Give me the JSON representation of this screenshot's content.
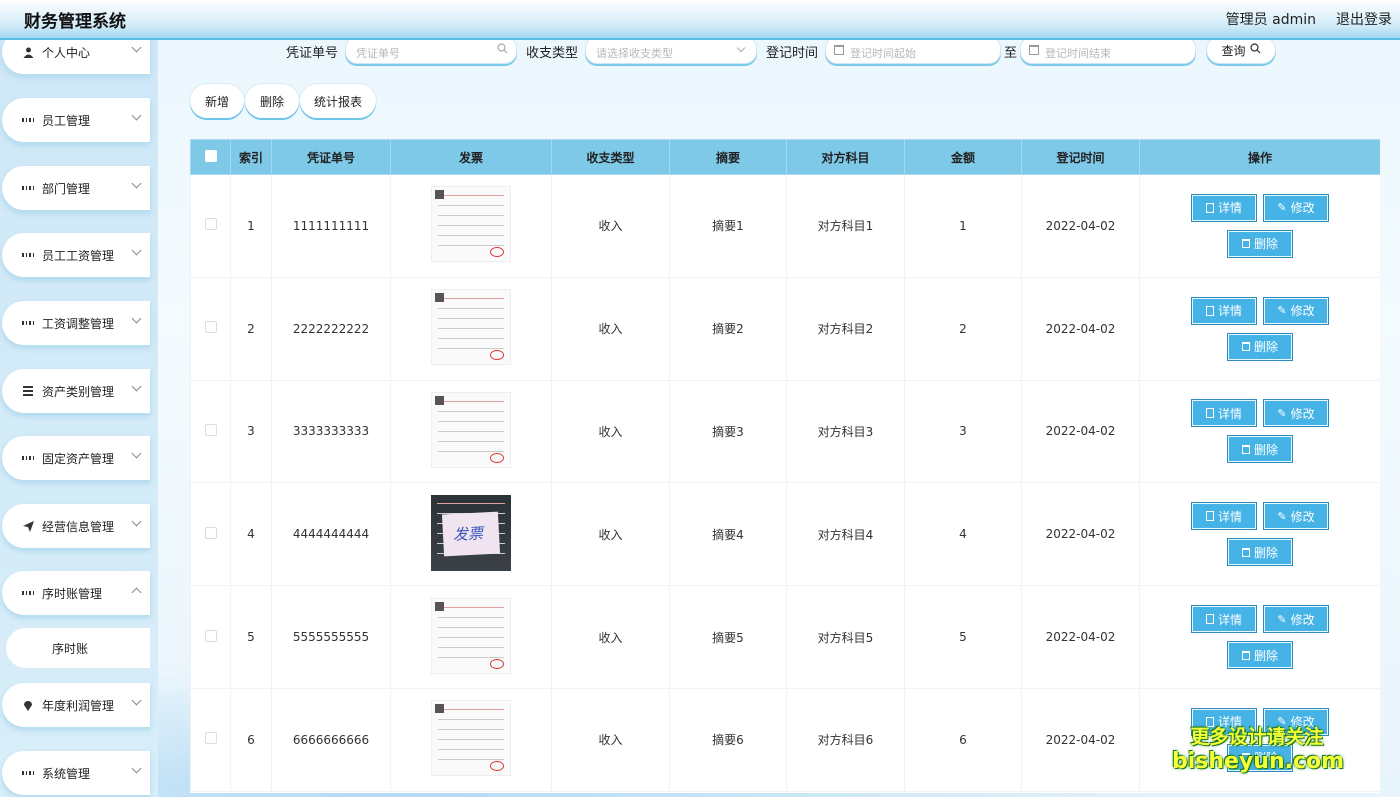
{
  "header": {
    "title": "财务管理系统",
    "user": "管理员 admin",
    "logout": "退出登录"
  },
  "sidebar": {
    "items": [
      {
        "label": "个人中心",
        "icon": "user-icon"
      },
      {
        "label": "员工管理",
        "icon": "grid-icon"
      },
      {
        "label": "部门管理",
        "icon": "grid-icon"
      },
      {
        "label": "员工工资管理",
        "icon": "grid-icon"
      },
      {
        "label": "工资调整管理",
        "icon": "grid-icon"
      },
      {
        "label": "资产类别管理",
        "icon": "list-icon"
      },
      {
        "label": "固定资产管理",
        "icon": "grid-icon"
      },
      {
        "label": "经营信息管理",
        "icon": "send-icon"
      },
      {
        "label": "序时账管理",
        "icon": "grid-icon"
      },
      {
        "label": "年度利润管理",
        "icon": "pin-icon"
      },
      {
        "label": "系统管理",
        "icon": "grid-icon"
      }
    ],
    "sub_item": "序时账"
  },
  "search": {
    "voucher_label": "凭证单号",
    "voucher_placeholder": "凭证单号",
    "type_label": "收支类型",
    "type_placeholder": "请选择收支类型",
    "time_label": "登记时间",
    "time_start_placeholder": "登记时间起始",
    "to_label": "至",
    "time_end_placeholder": "登记时间结束",
    "query_button": "查询"
  },
  "actions": {
    "add": "新增",
    "delete": "删除",
    "report": "统计报表"
  },
  "table": {
    "headers": [
      "索引",
      "凭证单号",
      "发票",
      "收支类型",
      "摘要",
      "对方科目",
      "金额",
      "登记时间",
      "操作"
    ],
    "rows": [
      {
        "index": "1",
        "voucher": "1111111111",
        "type": "收入",
        "summary": "摘要1",
        "account": "对方科目1",
        "amount": "1",
        "date": "2022-04-02"
      },
      {
        "index": "2",
        "voucher": "2222222222",
        "type": "收入",
        "summary": "摘要2",
        "account": "对方科目2",
        "amount": "2",
        "date": "2022-04-02"
      },
      {
        "index": "3",
        "voucher": "3333333333",
        "type": "收入",
        "summary": "摘要3",
        "account": "对方科目3",
        "amount": "3",
        "date": "2022-04-02"
      },
      {
        "index": "4",
        "voucher": "4444444444",
        "type": "收入",
        "summary": "摘要4",
        "account": "对方科目4",
        "amount": "4",
        "date": "2022-04-02"
      },
      {
        "index": "5",
        "voucher": "5555555555",
        "type": "收入",
        "summary": "摘要5",
        "account": "对方科目5",
        "amount": "5",
        "date": "2022-04-02"
      },
      {
        "index": "6",
        "voucher": "6666666666",
        "type": "收入",
        "summary": "摘要6",
        "account": "对方科目6",
        "amount": "6",
        "date": "2022-04-02"
      }
    ],
    "op_detail": "详情",
    "op_edit": "修改",
    "op_delete": "删除",
    "invoice_photo_text": "发票"
  },
  "watermark": {
    "line1": "更多设计请关注",
    "line2": "bisheyun.com"
  }
}
